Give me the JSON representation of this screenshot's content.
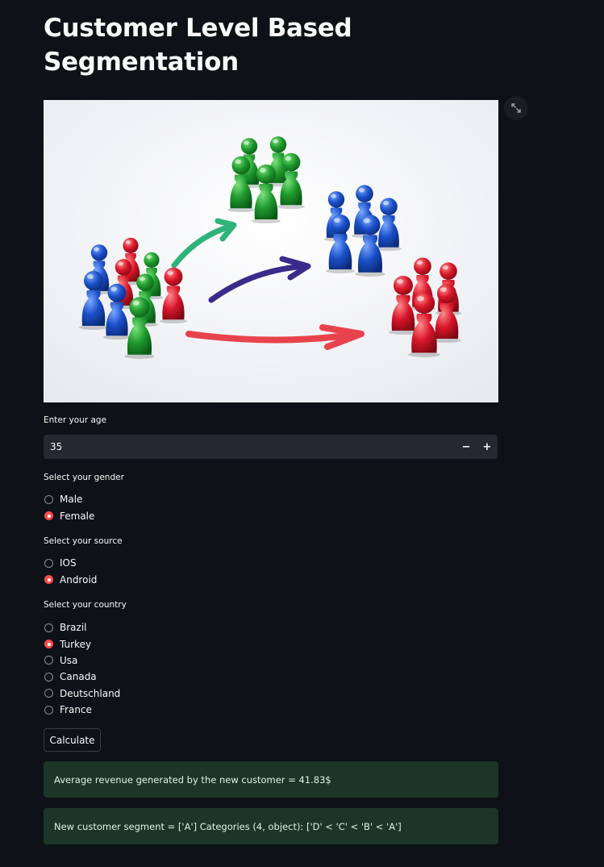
{
  "page": {
    "title": "Customer Level Based Segmentation"
  },
  "hero_image": {
    "description_icon": "segmentation-pawns-image"
  },
  "age_input": {
    "label": "Enter your age",
    "value": "35",
    "minus": "−",
    "plus": "+"
  },
  "gender": {
    "label": "Select your gender",
    "options": [
      "Male",
      "Female"
    ],
    "selected": "Female"
  },
  "source": {
    "label": "Select your source",
    "options": [
      "IOS",
      "Android"
    ],
    "selected": "Android"
  },
  "country": {
    "label": "Select your country",
    "options": [
      "Brazil",
      "Turkey",
      "Usa",
      "Canada",
      "Deutschland",
      "France"
    ],
    "selected": "Turkey"
  },
  "calculate_label": "Calculate",
  "results": {
    "revenue": "Average revenue generated by the new customer = 41.83$",
    "segment": "New customer segment = ['A'] Categories (4, object): ['D' < 'C' < 'B' < 'A']"
  },
  "colors": {
    "background": "#0e1117",
    "accent": "#ff4b4b",
    "success_bg": "#1c3527",
    "input_bg": "#262730"
  }
}
